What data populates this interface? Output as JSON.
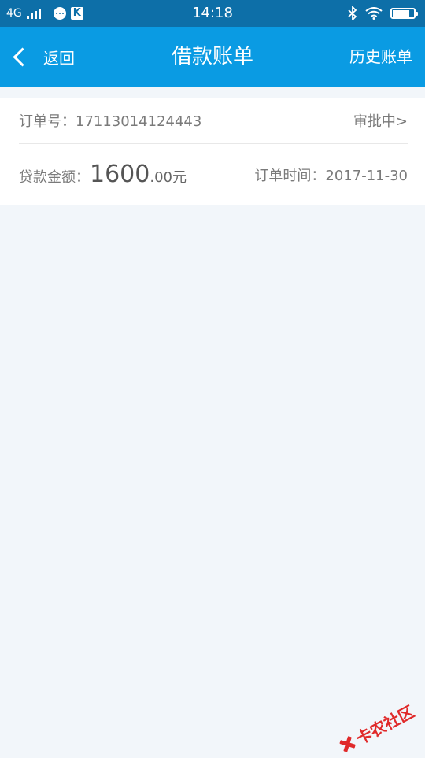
{
  "status_bar": {
    "network": "4G",
    "time": "14:18",
    "icons": [
      "signal-icon",
      "chat-icon",
      "k-app-icon",
      "bluetooth-icon",
      "wifi-icon",
      "battery-icon"
    ]
  },
  "navbar": {
    "back_label": "返回",
    "title": "借款账单",
    "history_label": "历史账单"
  },
  "order": {
    "number_label": "订单号：",
    "number": "17113014124443",
    "status": "审批中>",
    "amount_label": "贷款金额：",
    "amount_int": "1600",
    "amount_dec": ".00元",
    "time_label": "订单时间：",
    "time": "2017-11-30"
  },
  "watermark": {
    "text": "卡农社区"
  },
  "colors": {
    "status_bar": "#0d6fa8",
    "nav_bar": "#0a9be3",
    "background": "#f2f6fa",
    "watermark": "#e02a2a"
  }
}
